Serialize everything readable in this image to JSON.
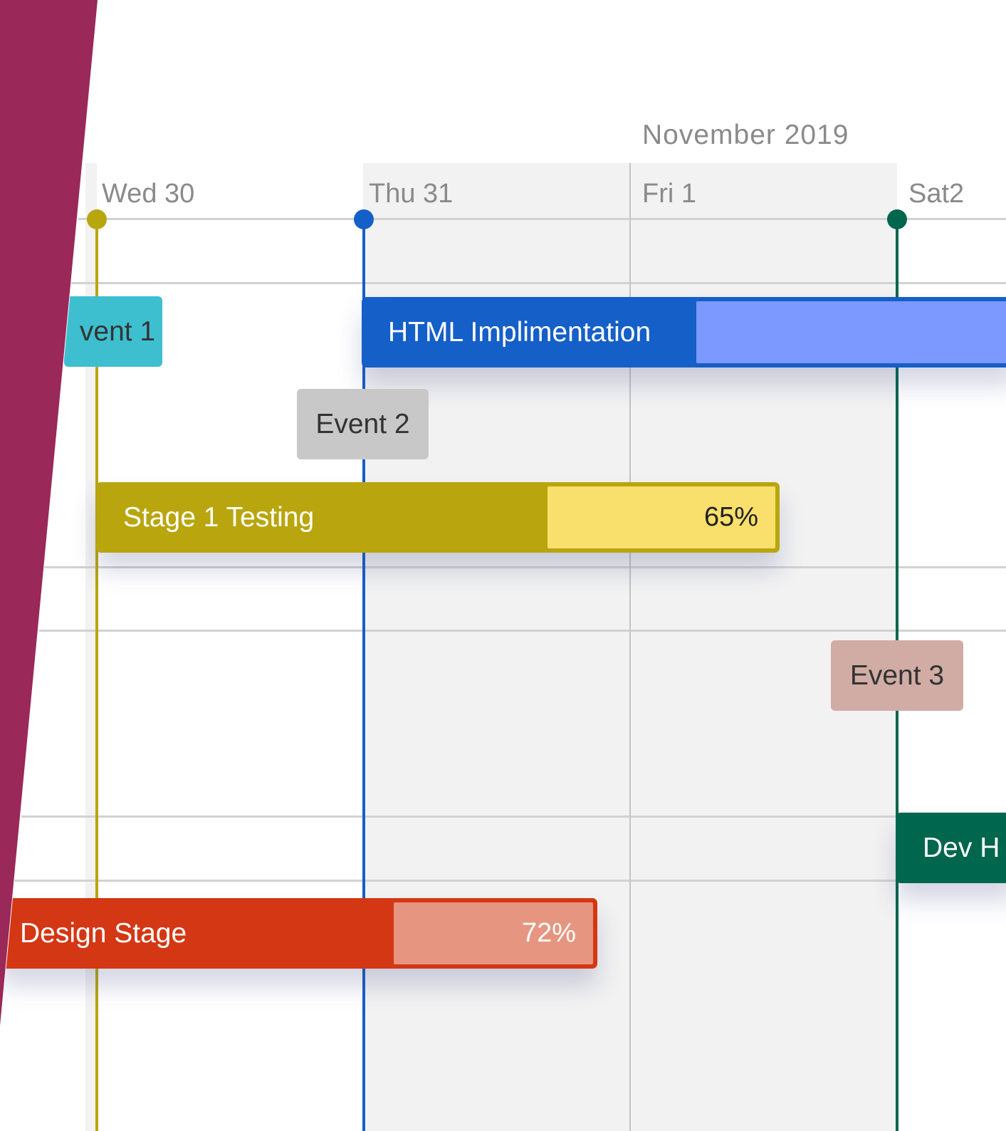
{
  "timeline": {
    "month_label": "November 2019",
    "days": [
      "Wed 30",
      "Thu 31",
      "Fri 1",
      "Sat2"
    ]
  },
  "events": [
    {
      "label": "vent 1",
      "color": "#3dbfcf"
    },
    {
      "label": "Event 2",
      "color": "#c8c8c8"
    },
    {
      "label": "Event 3",
      "color": "#d1aca5"
    }
  ],
  "tasks": [
    {
      "label": "HTML Implimentation",
      "color": "#155fc8",
      "fill_color": "#7b99ff"
    },
    {
      "label": "Stage 1 Testing",
      "color": "#b9a60e",
      "fill_color": "#f9e06c",
      "progress": "65%"
    },
    {
      "label": "Dev H",
      "color": "#00664d"
    },
    {
      "label": "Design Stage",
      "color": "#d43713",
      "fill_color": "#e69580",
      "progress": "72%"
    }
  ],
  "markers": {
    "wed_color": "#b9a60e",
    "thu_color": "#155fc8",
    "sat_color": "#00664d"
  },
  "accent_wedge_color": "#9a2858"
}
